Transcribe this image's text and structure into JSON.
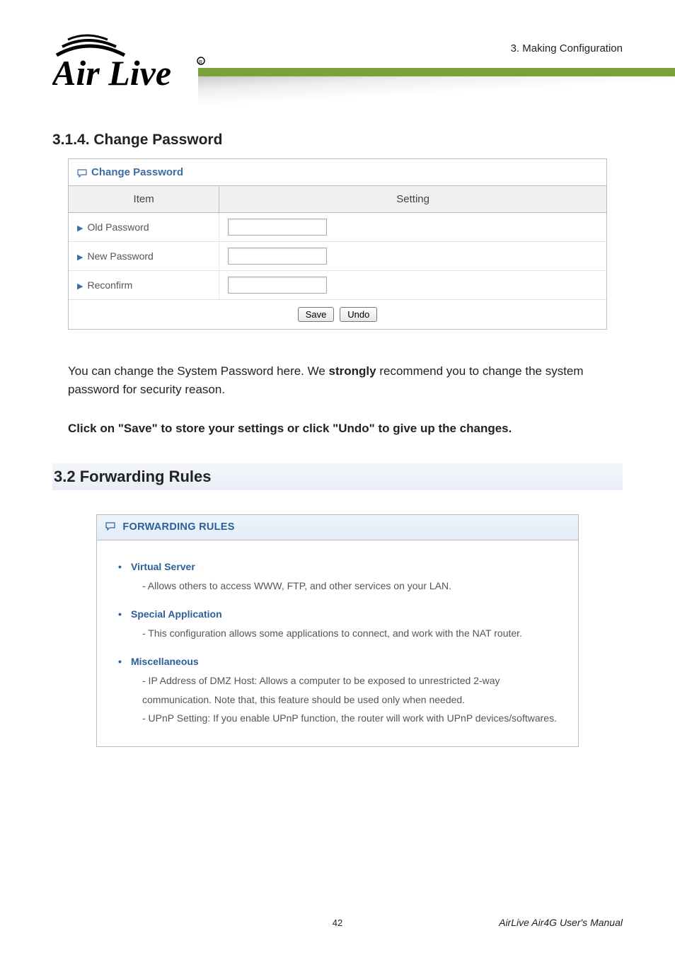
{
  "header": {
    "chapter_ref": "3. Making Configuration",
    "logo_text_1": "Air",
    "logo_text_2": "Live"
  },
  "section_314": {
    "heading": "3.1.4.  Change Password",
    "panel_title": "Change Password",
    "columns": {
      "item": "Item",
      "setting": "Setting"
    },
    "rows": {
      "old": "Old Password",
      "new": "New Password",
      "reconfirm": "Reconfirm"
    },
    "buttons": {
      "save": "Save",
      "undo": "Undo"
    }
  },
  "body": {
    "p1_a": "You can change the System Password here. We ",
    "p1_b": "strongly",
    "p1_c": " recommend you to change the system password for security reason.",
    "p2": "Click on \"Save\" to store your settings or click \"Undo\" to give up the changes."
  },
  "section_32": {
    "heading": "3.2  Forwarding Rules",
    "panel_title": "FORWARDING RULES",
    "items": [
      {
        "title": "Virtual Server",
        "desc": "- Allows others to access WWW, FTP, and other services on your LAN."
      },
      {
        "title": "Special Application",
        "desc": "- This configuration allows some applications to connect, and work with the NAT router."
      },
      {
        "title": "Miscellaneous",
        "desc": "- IP Address of DMZ Host: Allows a computer to be exposed to unrestricted 2-way communication. Note that, this feature should be used only when needed.\n- UPnP Setting: If you enable UPnP function, the router will work with UPnP devices/softwares."
      }
    ]
  },
  "footer": {
    "page": "42",
    "manual": "AirLive Air4G User's Manual"
  }
}
